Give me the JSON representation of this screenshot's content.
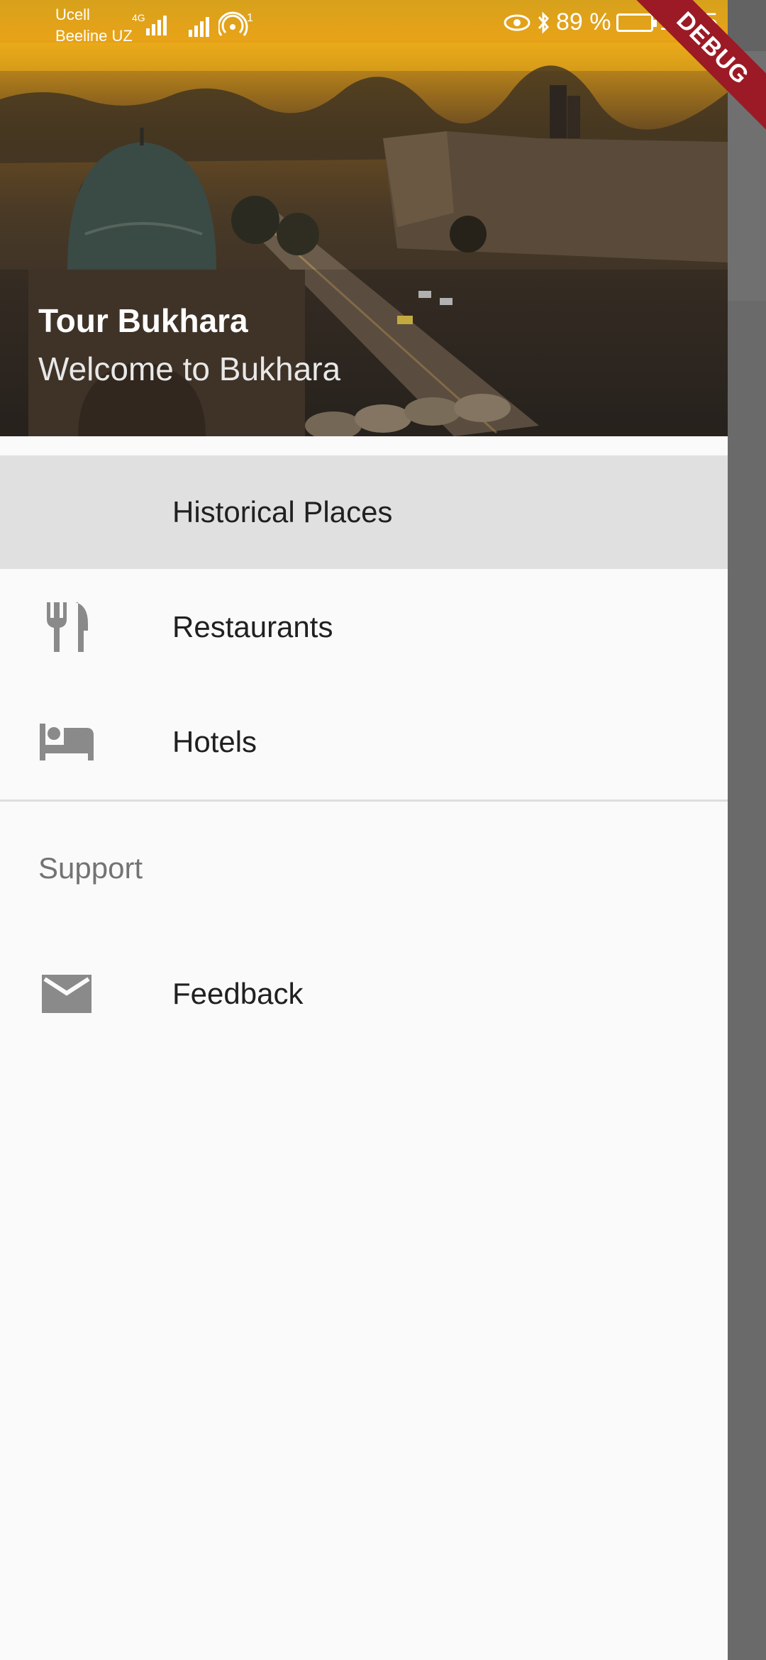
{
  "status_bar": {
    "carrier_primary": "Ucell",
    "carrier_secondary": "Beeline UZ",
    "network_badge": "4G",
    "hotspot_count": "1",
    "battery_percent": "89 %",
    "time": "11:15"
  },
  "debug_banner": "DEBUG",
  "drawer": {
    "header": {
      "title": "Tour Bukhara",
      "subtitle": "Welcome to Bukhara"
    },
    "items": [
      {
        "label": "Historical Places",
        "icon": "",
        "selected": true
      },
      {
        "label": "Restaurants",
        "icon": "restaurant-icon",
        "selected": false
      },
      {
        "label": "Hotels",
        "icon": "hotel-bed-icon",
        "selected": false
      }
    ],
    "section_title": "Support",
    "support_items": [
      {
        "label": "Feedback",
        "icon": "mail-icon"
      }
    ]
  },
  "colors": {
    "selected_background": "#e0e0e0",
    "drawer_background": "#fafafa",
    "icon_gray": "#8a8a8a",
    "debug_red": "#9b1a25"
  }
}
